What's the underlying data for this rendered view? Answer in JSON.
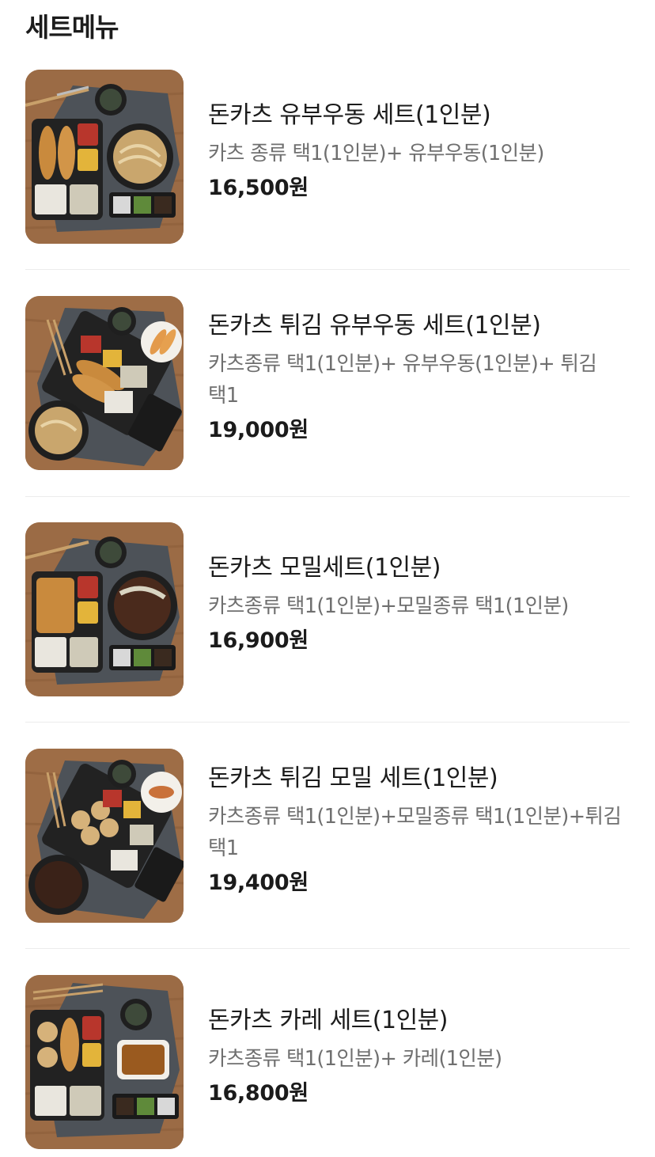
{
  "section": {
    "title": "세트메뉴"
  },
  "items": [
    {
      "name": "돈카츠 유부우동 세트(1인분)",
      "desc": "카츠 종류 택1(1인분)+ 유부우동(1인분)",
      "price": "16,500원",
      "image": "tonkatsu-udon-set-photo"
    },
    {
      "name": "돈카츠 튀김 유부우동 세트(1인분)",
      "desc": "카츠종류 택1(1인분)+ 유부우동(1인분)+ 튀김 택1",
      "price": "19,000원",
      "image": "tonkatsu-tempura-udon-set-photo"
    },
    {
      "name": "돈카츠 모밀세트(1인분)",
      "desc": "카츠종류 택1(1인분)+모밀종류 택1(1인분)",
      "price": "16,900원",
      "image": "tonkatsu-soba-set-photo"
    },
    {
      "name": "돈카츠 튀김 모밀 세트(1인분)",
      "desc": "카츠종류 택1(1인분)+모밀종류 택1(1인분)+튀김 택1",
      "price": "19,400원",
      "image": "tonkatsu-tempura-soba-set-photo"
    },
    {
      "name": "돈카츠 카레 세트(1인분)",
      "desc": "카츠종류 택1(1인분)+ 카레(1인분)",
      "price": "16,800원",
      "image": "tonkatsu-curry-set-photo"
    }
  ]
}
